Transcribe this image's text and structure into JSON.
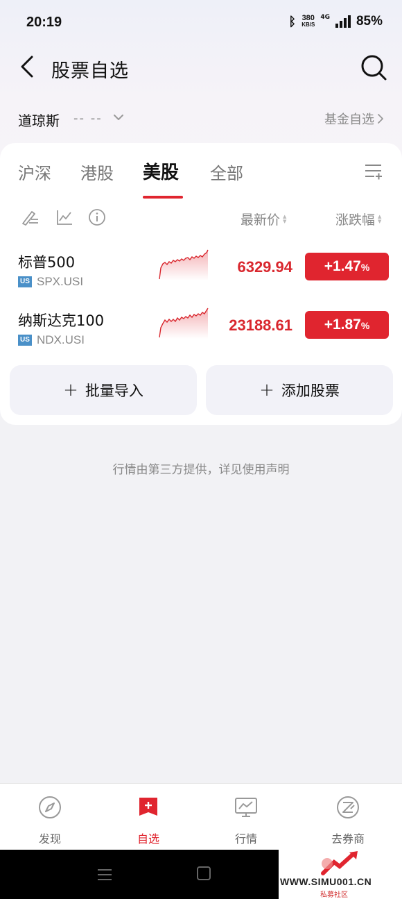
{
  "status_bar": {
    "time": "20:19",
    "speed_value": "380",
    "speed_unit": "KB/S",
    "network": "4G",
    "battery": "85%"
  },
  "nav": {
    "title": "股票自选"
  },
  "index_bar": {
    "name": "道琼斯",
    "value": "-- --",
    "fund_link": "基金自选"
  },
  "tabs": [
    {
      "label": "沪深",
      "active": false
    },
    {
      "label": "港股",
      "active": false
    },
    {
      "label": "美股",
      "active": true
    },
    {
      "label": "全部",
      "active": false
    }
  ],
  "columns": {
    "price": "最新价",
    "change": "涨跌幅"
  },
  "stocks": [
    {
      "name": "标普500",
      "market": "US",
      "code": "SPX.USI",
      "price": "6329.94",
      "change": "+1.47",
      "unit": "%"
    },
    {
      "name": "纳斯达克100",
      "market": "US",
      "code": "NDX.USI",
      "price": "23188.61",
      "change": "+1.87",
      "unit": "%"
    }
  ],
  "actions": {
    "batch_import": "批量导入",
    "add_stock": "添加股票"
  },
  "disclaimer": "行情由第三方提供，详见使用声明",
  "bottom_tabs": [
    {
      "label": "发现",
      "icon": "compass-icon",
      "active": false
    },
    {
      "label": "自选",
      "icon": "add-watchlist-icon",
      "active": true
    },
    {
      "label": "行情",
      "icon": "monitor-chart-icon",
      "active": false
    },
    {
      "label": "去券商",
      "icon": "broker-icon",
      "active": false
    }
  ],
  "watermark": {
    "site": "WWW.SIMU001.CN",
    "sub": "私募社区"
  },
  "colors": {
    "accent": "#e0252f",
    "rise": "#d9272e",
    "badge_us": "#4a90c8"
  }
}
